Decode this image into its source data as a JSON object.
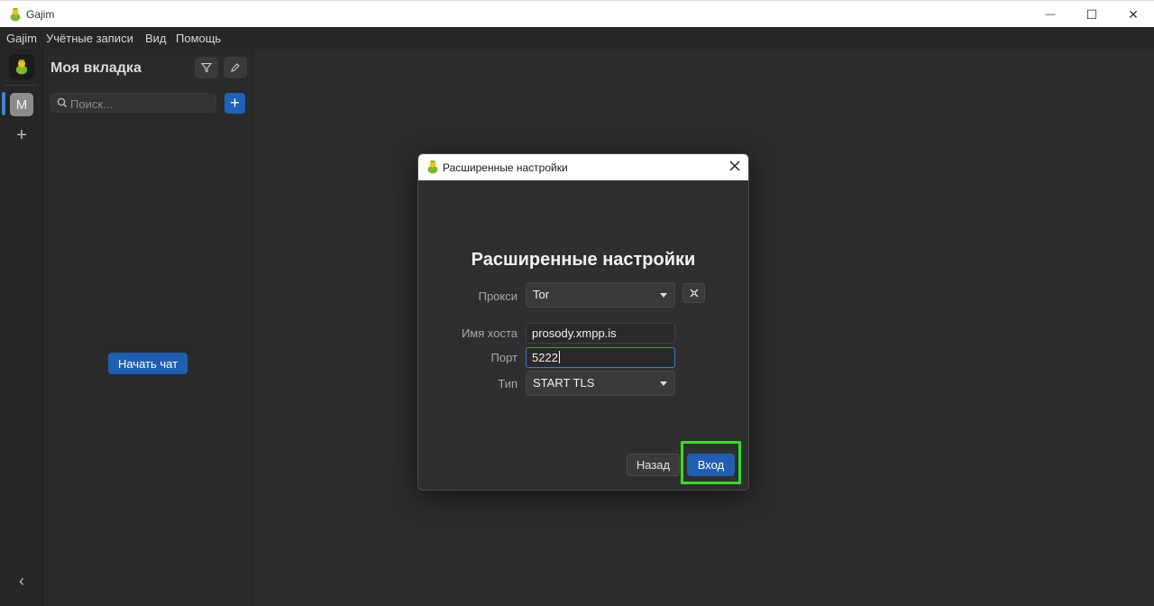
{
  "window": {
    "title": "Gajim",
    "minimize_glyph": "—",
    "maximize_glyph": "☐",
    "close_glyph": "✕"
  },
  "menubar": {
    "items": [
      "Gajim",
      "Учётные записи",
      "Вид",
      "Помощь"
    ]
  },
  "rail": {
    "account_initial": "M",
    "add_glyph": "+",
    "collapse_glyph": "‹"
  },
  "sidebar": {
    "workspace_title": "Моя вкладка",
    "search_placeholder": "Поиск...",
    "new_chat_glyph": "+",
    "start_chat_label": "Начать чат"
  },
  "dialog": {
    "window_title": "Расширенные настройки",
    "heading": "Расширенные настройки",
    "proxy_label": "Прокси",
    "proxy_value": "Tor",
    "hostname_label": "Имя хоста",
    "hostname_value": "prosody.xmpp.is",
    "port_label": "Порт",
    "port_value": "5222",
    "type_label": "Тип",
    "type_value": "START TLS",
    "back_label": "Назад",
    "login_label": "Вход"
  },
  "colors": {
    "accent": "#1f5fb1",
    "highlight": "#2ee21f",
    "background": "#2d2d2d"
  }
}
